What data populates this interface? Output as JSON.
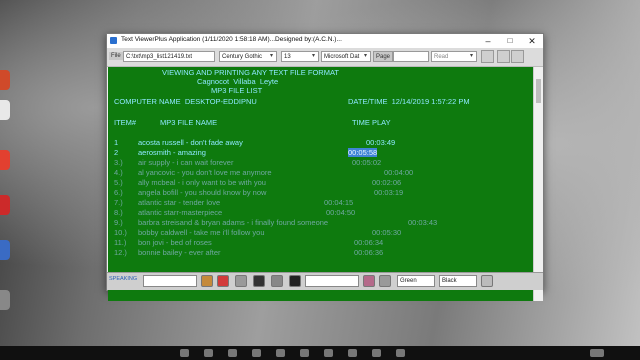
{
  "window": {
    "title": "Text ViewerPlus Application (1/11/2020 1:58:18 AM)...Designed by:(A.C.N.)..."
  },
  "toolbar": {
    "file_label": "File",
    "file_path": "C:\\txt\\mp3_list121419.txt",
    "font": "Century Gothic",
    "size": "13",
    "font2": "Microsoft Dat",
    "page_label": "Page",
    "mode": "Read"
  },
  "header": {
    "line1": "VIEWING AND PRINTING ANY TEXT FILE FORMAT",
    "line2": "Cagnocot  Villaba  Leyte",
    "line3": "MP3 FILE LIST",
    "computer": "COMPUTER NAME  DESKTOP-EDDIPNU",
    "datetime": "DATE/TIME  12/14/2019 1:57:22 PM",
    "col_item": "ITEM#",
    "col_file": "MP3 FILE NAME",
    "col_time": "TIME PLAY"
  },
  "rows": [
    {
      "num": "1",
      "name": "acosta russell - don't fade away",
      "time": "00:03:49"
    },
    {
      "num": "2",
      "name": "aerosmith - amazing",
      "time": "00:05:58"
    },
    {
      "num": "3.)",
      "name": "air supply - i can wait forever",
      "time": "00:05:02"
    },
    {
      "num": "4.)",
      "name": "al yancovic - you don't love me anymore",
      "time": "00:04:00"
    },
    {
      "num": "5.)",
      "name": "ally mcbeal - i only want to be with you",
      "time": "00:02:06"
    },
    {
      "num": "6.)",
      "name": "angela bofill - you should know by now",
      "time": "00:03:19"
    },
    {
      "num": "7.)",
      "name": "atlantic star - tender love",
      "time": "00:04:15"
    },
    {
      "num": "8.)",
      "name": "atlantic starr-masterpiece",
      "time": "00:04:50"
    },
    {
      "num": "9.)",
      "name": "barbra streisand & bryan adams - i finally found someone",
      "time": "00:03:43"
    },
    {
      "num": "10.)",
      "name": "bobby caldwell - take me i'll follow you",
      "time": "00:05:30"
    },
    {
      "num": "11.)",
      "name": "bon jovi - bed of roses",
      "time": "00:06:34"
    },
    {
      "num": "12.)",
      "name": "bonnie bailey - ever after",
      "time": "00:06:36"
    }
  ],
  "bottom": {
    "speak_label": "SPEAKING",
    "color": "Green",
    "bgcolor": "Black"
  },
  "colors": {
    "content_bg": "#0e7a0e",
    "text_cyan": "#8fe8ff",
    "highlight": "#3f84d6"
  }
}
